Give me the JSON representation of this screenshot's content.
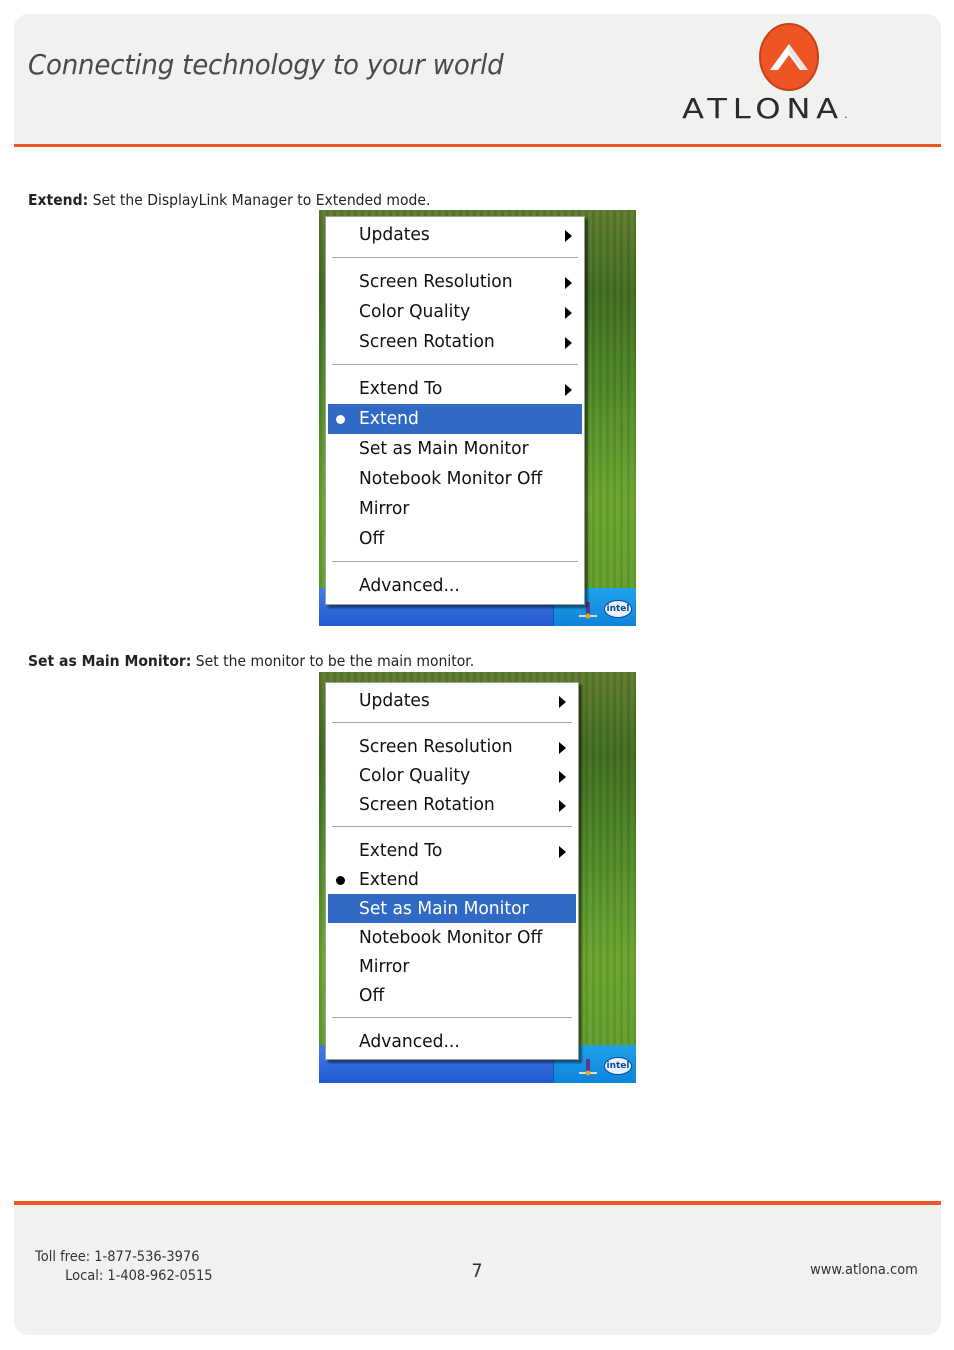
{
  "header": {
    "tagline": "Connecting technology to your world",
    "brand": "ATLONA",
    "brand_mark": ".",
    "accent_color": "#ee5524"
  },
  "sections": [
    {
      "caption_bold": "Extend:",
      "caption_text": " Set the DisplayLink Manager to Extended mode.",
      "menu": {
        "items": [
          {
            "label": "Updates",
            "submenu": true
          },
          {
            "label": "Screen Resolution",
            "submenu": true
          },
          {
            "label": "Color Quality",
            "submenu": true
          },
          {
            "label": "Screen Rotation",
            "submenu": true
          },
          {
            "label": "Extend To",
            "submenu": true
          },
          {
            "label": "Extend",
            "checked": true,
            "highlighted": true
          },
          {
            "label": "Set as Main Monitor"
          },
          {
            "label": "Notebook Monitor Off"
          },
          {
            "label": "Mirror"
          },
          {
            "label": "Off"
          },
          {
            "label": "Advanced..."
          }
        ]
      },
      "tray": {
        "intel_label": "intel"
      }
    },
    {
      "caption_bold": "Set as Main Monitor:",
      "caption_text": " Set the monitor to be the main monitor.",
      "menu": {
        "items": [
          {
            "label": "Updates",
            "submenu": true
          },
          {
            "label": "Screen Resolution",
            "submenu": true
          },
          {
            "label": "Color Quality",
            "submenu": true
          },
          {
            "label": "Screen Rotation",
            "submenu": true
          },
          {
            "label": "Extend To",
            "submenu": true
          },
          {
            "label": "Extend",
            "checked": true
          },
          {
            "label": "Set as Main Monitor",
            "highlighted": true
          },
          {
            "label": "Notebook Monitor Off"
          },
          {
            "label": "Mirror"
          },
          {
            "label": "Off"
          },
          {
            "label": "Advanced..."
          }
        ]
      },
      "tray": {
        "intel_label": "intel"
      }
    }
  ],
  "footer": {
    "toll_free": "Toll free: 1-877-536-3976",
    "local": "Local: 1-408-962-0515",
    "page_number": "7",
    "website": "www.atlona.com"
  }
}
